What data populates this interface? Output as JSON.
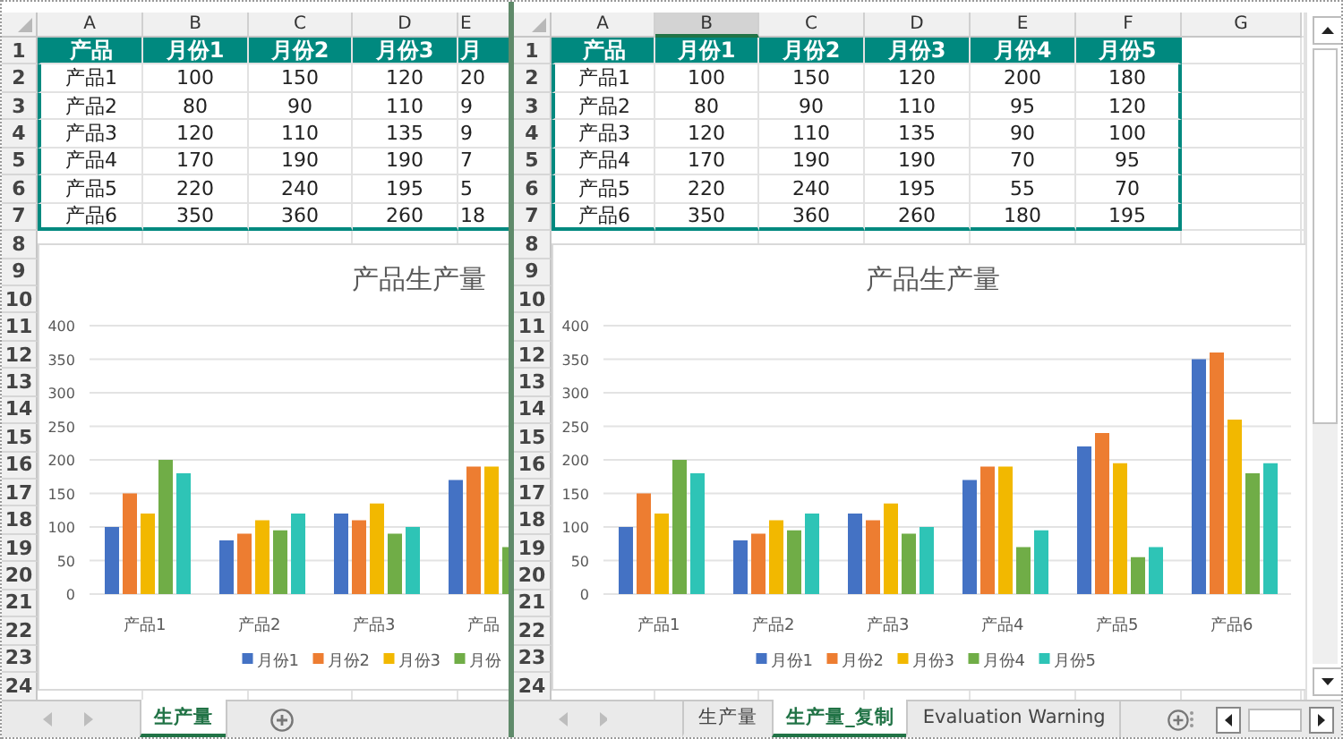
{
  "panes": [
    {
      "columns": [
        {
          "label": "A",
          "selected": false
        },
        {
          "label": "B",
          "selected": false
        },
        {
          "label": "C",
          "selected": false
        },
        {
          "label": "D",
          "selected": false
        },
        {
          "label": "E",
          "selected": false
        }
      ],
      "row_numbers": [
        "1",
        "2",
        "3",
        "4",
        "5",
        "6",
        "7",
        "8",
        "9",
        "10",
        "11",
        "12",
        "13",
        "14",
        "15",
        "16",
        "17",
        "18",
        "19",
        "20",
        "21",
        "22",
        "23",
        "24"
      ],
      "table": [
        [
          "产品",
          "月份1",
          "月份2",
          "月份3",
          "月"
        ],
        [
          "产品1",
          "100",
          "150",
          "120",
          "20"
        ],
        [
          "产品2",
          "80",
          "90",
          "110",
          "9"
        ],
        [
          "产品3",
          "120",
          "110",
          "135",
          "9"
        ],
        [
          "产品4",
          "170",
          "190",
          "190",
          "7"
        ],
        [
          "产品5",
          "220",
          "240",
          "195",
          "5"
        ],
        [
          "产品6",
          "350",
          "360",
          "260",
          "18"
        ]
      ],
      "chart_data": {
        "type": "bar",
        "title": "产品生产量",
        "grid": true,
        "legend": "bottom",
        "categories": [
          "产品1",
          "产品2",
          "产品3",
          "产品"
        ],
        "ylim": [
          0,
          400
        ],
        "yticks": [
          0,
          50,
          100,
          150,
          200,
          250,
          300,
          350,
          400
        ],
        "series": [
          {
            "name": "月份1",
            "color": "#4472c4",
            "values": [
              100,
              80,
              120,
              170
            ]
          },
          {
            "name": "月份2",
            "color": "#ed7d31",
            "values": [
              150,
              90,
              110,
              190
            ]
          },
          {
            "name": "月份3",
            "color": "#f2b800",
            "values": [
              120,
              110,
              135,
              190
            ]
          },
          {
            "name": "月份",
            "color": "#70ad47",
            "values": [
              200,
              95,
              90,
              70
            ]
          },
          {
            "name": null,
            "color": "#2ec4b6",
            "values": [
              180,
              120,
              100,
              null
            ]
          }
        ]
      },
      "sheet_tabs": [
        {
          "label": "生产量",
          "selected": true
        }
      ]
    },
    {
      "columns": [
        {
          "label": "A",
          "selected": false
        },
        {
          "label": "B",
          "selected": true
        },
        {
          "label": "C",
          "selected": false
        },
        {
          "label": "D",
          "selected": false
        },
        {
          "label": "E",
          "selected": false
        },
        {
          "label": "F",
          "selected": false
        },
        {
          "label": "G",
          "selected": false
        }
      ],
      "row_numbers": [
        "1",
        "2",
        "3",
        "4",
        "5",
        "6",
        "7",
        "8",
        "9",
        "10",
        "11",
        "12",
        "13",
        "14",
        "15",
        "16",
        "17",
        "18",
        "19",
        "20",
        "21",
        "22",
        "23",
        "24"
      ],
      "table": [
        [
          "产品",
          "月份1",
          "月份2",
          "月份3",
          "月份4",
          "月份5"
        ],
        [
          "产品1",
          "100",
          "150",
          "120",
          "200",
          "180"
        ],
        [
          "产品2",
          "80",
          "90",
          "110",
          "95",
          "120"
        ],
        [
          "产品3",
          "120",
          "110",
          "135",
          "90",
          "100"
        ],
        [
          "产品4",
          "170",
          "190",
          "190",
          "70",
          "95"
        ],
        [
          "产品5",
          "220",
          "240",
          "195",
          "55",
          "70"
        ],
        [
          "产品6",
          "350",
          "360",
          "260",
          "180",
          "195"
        ]
      ],
      "chart_data": {
        "type": "bar",
        "title": "产品生产量",
        "grid": true,
        "legend": "bottom",
        "categories": [
          "产品1",
          "产品2",
          "产品3",
          "产品4",
          "产品5",
          "产品6"
        ],
        "ylim": [
          0,
          400
        ],
        "yticks": [
          0,
          50,
          100,
          150,
          200,
          250,
          300,
          350,
          400
        ],
        "series": [
          {
            "name": "月份1",
            "color": "#4472c4",
            "values": [
              100,
              80,
              120,
              170,
              220,
              350
            ]
          },
          {
            "name": "月份2",
            "color": "#ed7d31",
            "values": [
              150,
              90,
              110,
              190,
              240,
              360
            ]
          },
          {
            "name": "月份3",
            "color": "#f2b800",
            "values": [
              120,
              110,
              135,
              190,
              195,
              260
            ]
          },
          {
            "name": "月份4",
            "color": "#70ad47",
            "values": [
              200,
              95,
              90,
              70,
              55,
              180
            ]
          },
          {
            "name": "月份5",
            "color": "#2ec4b6",
            "values": [
              180,
              120,
              100,
              95,
              70,
              195
            ]
          }
        ]
      },
      "sheet_tabs": [
        {
          "label": "生产量",
          "selected": false
        },
        {
          "label": "生产量_复制",
          "selected": true
        },
        {
          "label": "Evaluation Warning",
          "selected": false
        }
      ]
    }
  ]
}
